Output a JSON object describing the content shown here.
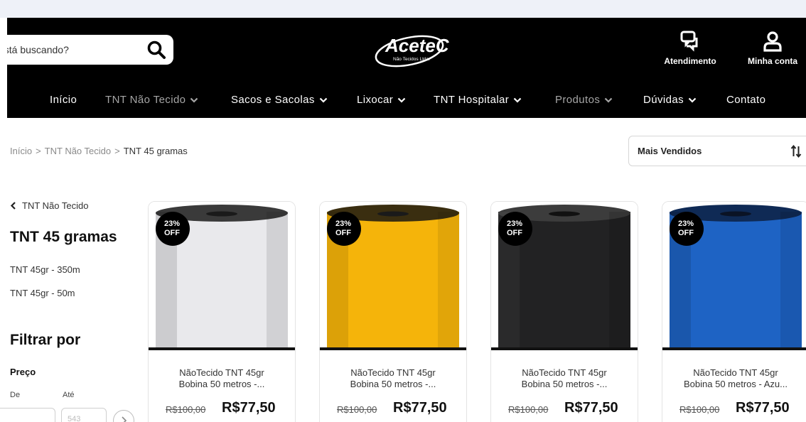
{
  "header": {
    "search": {
      "placeholder": "está buscando?"
    },
    "logo": {
      "name": "AceteC",
      "tagline": "Não Tecidos Ltda."
    },
    "support_label": "Atendimento",
    "account_label": "Minha conta"
  },
  "nav": {
    "items": [
      {
        "label": "Início"
      },
      {
        "label": "TNT Não Tecido"
      },
      {
        "label": "Sacos e Sacolas"
      },
      {
        "label": "Lixocar"
      },
      {
        "label": "TNT Hospitalar"
      },
      {
        "label": "Produtos"
      },
      {
        "label": "Dúvidas"
      },
      {
        "label": "Contato"
      }
    ]
  },
  "breadcrumb": {
    "home": "Início",
    "parent": "TNT Não Tecido",
    "current": "TNT 45 gramas",
    "separator": ">"
  },
  "sort": {
    "selected": "Mais Vendidos"
  },
  "sidebar": {
    "back_label": "TNT Não Tecido",
    "title": "TNT 45 gramas",
    "links": [
      "TNT 45gr - 350m",
      "TNT 45gr - 50m"
    ],
    "filter_title": "Filtrar por",
    "price_label": "Preço",
    "from_label": "De",
    "to_label": "Até",
    "to_placeholder": "543"
  },
  "products": [
    {
      "line1": "NãoTecido TNT 45gr",
      "line2": "Bobina 50 metros -...",
      "old_price": "R$100,00",
      "price": "R$77,50",
      "badge_pct": "23%",
      "badge_off": "OFF",
      "color": "#e9e9ec"
    },
    {
      "line1": "NãoTecido TNT 45gr",
      "line2": "Bobina 50 metros -...",
      "old_price": "R$100,00",
      "price": "R$77,50",
      "badge_pct": "23%",
      "badge_off": "OFF",
      "color": "#f5b40a"
    },
    {
      "line1": "NãoTecido TNT 45gr",
      "line2": "Bobina 50 metros -...",
      "old_price": "R$100,00",
      "price": "R$77,50",
      "badge_pct": "23%",
      "badge_off": "OFF",
      "color": "#222223"
    },
    {
      "line1": "NãoTecido TNT 45gr",
      "line2": "Bobina 50 metros - Azu...",
      "old_price": "R$100,00",
      "price": "R$77,50",
      "badge_pct": "23%",
      "badge_off": "OFF",
      "color": "#1e63c4"
    }
  ]
}
